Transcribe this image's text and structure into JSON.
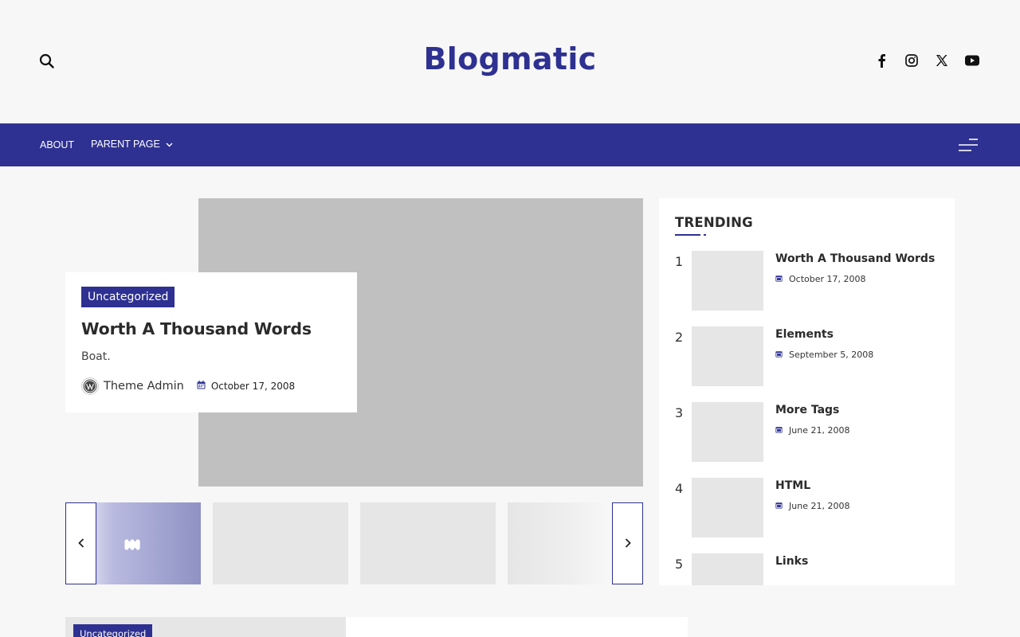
{
  "site": {
    "title": "Blogmatic"
  },
  "header": {
    "icons": {
      "search": "search-icon",
      "social": [
        "facebook-icon",
        "instagram-icon",
        "x-twitter-icon",
        "youtube-icon"
      ]
    }
  },
  "nav": {
    "items": [
      {
        "label": "ABOUT"
      },
      {
        "label": "PARENT PAGE",
        "icon": "chevron-down-icon"
      }
    ],
    "menu_icon": "hamburger-icon"
  },
  "colors": {
    "brand": "#2e3191",
    "background": "#f7f7f7",
    "placeholder": "#c0c0c0"
  },
  "hero": {
    "category": "Uncategorized",
    "title": "Worth A Thousand Words",
    "excerpt": "Boat.",
    "author": "Theme Admin",
    "date": "October 17, 2008"
  },
  "carousel": {
    "prev_icon": "chevron-left-icon",
    "next_icon": "chevron-right-icon",
    "active_icon": "grid-icon"
  },
  "trending": {
    "title": "TRENDING",
    "items": [
      {
        "rank": "1",
        "title": "Worth A Thousand Words",
        "date": "October 17, 2008"
      },
      {
        "rank": "2",
        "title": "Elements",
        "date": "September 5, 2008"
      },
      {
        "rank": "3",
        "title": "More Tags",
        "date": "June 21, 2008"
      },
      {
        "rank": "4",
        "title": "HTML",
        "date": "June 21, 2008"
      },
      {
        "rank": "5",
        "title": "Links",
        "date": ""
      }
    ]
  },
  "bottom": {
    "category": "Uncategorized"
  }
}
